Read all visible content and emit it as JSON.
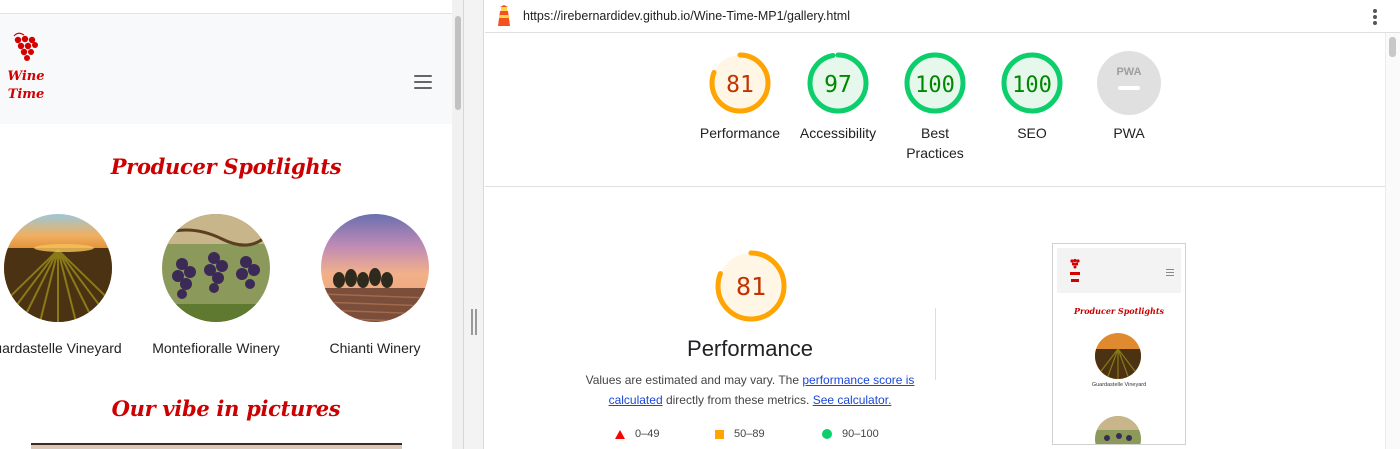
{
  "browser": {
    "url": "https://irebernardidev.github.io/Wine-Time-MP1/gallery.html",
    "lighthouse_icon": "lighthouse-icon",
    "menu_icon": "more-vertical-icon"
  },
  "mobile_site": {
    "logo_text_line1": "Wine",
    "logo_text_line2": "Time",
    "menu_icon": "hamburger-icon",
    "spotlights_heading": "Producer Spotlights",
    "producers": [
      {
        "name": "Guardastelle Vineyard",
        "visible_name": "uardastelle Vineyard"
      },
      {
        "name": "Montefioralle Winery",
        "visible_name": "Montefioralle Winery"
      },
      {
        "name": "Chianti Winery",
        "visible_name": "Chianti Winery"
      }
    ],
    "vibe_heading": "Our vibe in pictures"
  },
  "lighthouse": {
    "scores": [
      {
        "label": "Performance",
        "value": "81",
        "level": "average"
      },
      {
        "label": "Accessibility",
        "value": "97",
        "level": "pass"
      },
      {
        "label": "Best Practices",
        "label_line1": "Best",
        "label_line2": "Practices",
        "value": "100",
        "level": "pass"
      },
      {
        "label": "SEO",
        "value": "100",
        "level": "pass"
      },
      {
        "label": "PWA",
        "value": "PWA",
        "level": "na"
      }
    ],
    "colors": {
      "pass": "#0cce6b",
      "pass_text": "#008800",
      "pass_bg": "#e6f8ec",
      "average": "#ffa400",
      "average_text": "#c33300",
      "average_bg": "#fff6e6",
      "fail": "#ff0000",
      "na": "#e0e0e0"
    },
    "performance": {
      "score": "81",
      "title": "Performance",
      "desc_text_1": "Values are estimated and may vary. The",
      "desc_link_1": "performance score is calculated",
      "desc_text_2": "directly from these metrics.",
      "desc_link_2": "See calculator."
    },
    "legend": [
      {
        "range": "0–49",
        "shape": "triangle",
        "color": "#ff0000"
      },
      {
        "range": "50–89",
        "shape": "square",
        "color": "#ffa400"
      },
      {
        "range": "90–100",
        "shape": "circle",
        "color": "#0cce6b"
      }
    ],
    "screenshot_thumb": {
      "heading": "Producer Spotlights",
      "caption": "Guardastelle Vineyard"
    }
  }
}
